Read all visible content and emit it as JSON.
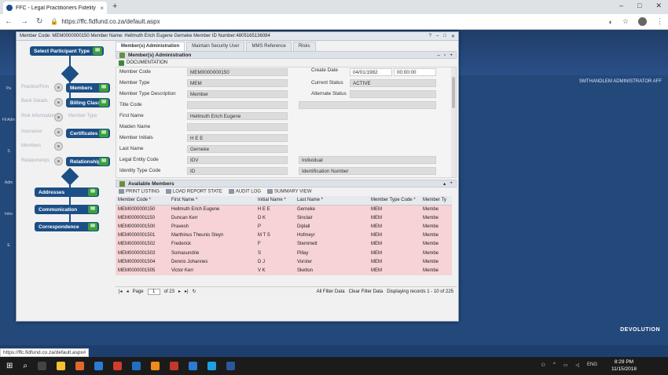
{
  "browser": {
    "tab_title": "FFC - Legal Practitioners Fidelity",
    "tab_close": "×",
    "new_tab": "+",
    "url": "https://ffc.fidfund.co.za/default.aspx",
    "status_url": "https://ffc.fidfund.co.za/default.aspx#",
    "win_controls": [
      "–",
      "□",
      "✕"
    ]
  },
  "app": {
    "user_bar": "SMTHANDLEM ADMINISTRATOR AFF",
    "brand": "DEVOLUTION",
    "side_labels": [
      "Pa",
      "Fil Adm",
      "S",
      "Adm",
      "Intro",
      "E"
    ]
  },
  "modal": {
    "title": "Member Code: MEM0000000150 Member Name: Hellmuth Erich Eugene Gerneke Member ID Number:4805165136084",
    "title_buttons": [
      "?",
      "–",
      "□",
      "✕"
    ]
  },
  "flow": {
    "start": "Select Participant Type",
    "members": "Members",
    "billing": "Billing Class",
    "certificates": "Certificates",
    "relationships": "Relationships",
    "addresses": "Addresses",
    "communication": "Communication",
    "correspondence": "Correspondence",
    "ghosts": [
      "Practice/Firm",
      "Bank Details",
      "Risk Information",
      "Member Type",
      "Insurance",
      "Members",
      "Relationships"
    ]
  },
  "tabs": [
    "Member(s) Administration",
    "Maintain Security User",
    "MMS Reference",
    "Risks"
  ],
  "admin_panel": {
    "title": "Member(s) Administration",
    "documentation": "DOCUMENTATION",
    "fields_left": [
      {
        "label": "Member Code",
        "value": "MEM0000000150"
      },
      {
        "label": "Member Type",
        "value": "MEM"
      },
      {
        "label": "Member Type Description",
        "value": "Member"
      },
      {
        "label": "Title Code",
        "value": ""
      },
      {
        "label": "First Name",
        "value": "Hellmuth Erich Eugene"
      },
      {
        "label": "Maiden Name",
        "value": ""
      },
      {
        "label": "Member Initials",
        "value": "H E E"
      },
      {
        "label": "Last Name",
        "value": "Gerneke"
      },
      {
        "label": "Legal Entity Code",
        "value": "IDV"
      },
      {
        "label": "Identity Type Code",
        "value": "ID"
      }
    ],
    "create_date_label": "Create Date",
    "create_date": "04/01/1982",
    "create_time": "00:00:00",
    "current_status_label": "Current Status",
    "current_status": "ACTIVE",
    "alternate_status_label": "Alternate Status",
    "legal_entity_desc": "Individual",
    "identity_type_desc": "Identification Number"
  },
  "available": {
    "title": "Available Members",
    "toolbar": [
      "PRINT LISTING",
      "LOAD REPORT STATE",
      "AUDIT LOG",
      "SUMMARY VIEW"
    ],
    "columns": [
      "Member Code *",
      "First Name *",
      "Initial Name *",
      "Last Name *",
      "Member Type Code *",
      "Member Ty"
    ],
    "rows": [
      [
        "MEM0000000150",
        "Hellmuth Erich Eugene",
        "H E E",
        "Gerneke",
        "MEM",
        "Membe"
      ],
      [
        "MEM0000001150",
        "Duncan Kerr",
        "D K",
        "Sinclair",
        "MEM",
        "Membe"
      ],
      [
        "MEM0000001500",
        "Pravesh",
        "P",
        "Diplall",
        "MEM",
        "Membe"
      ],
      [
        "MEM0000001501",
        "Marthinus Theunis Steyn",
        "M T S",
        "Hofmeyr",
        "MEM",
        "Membe"
      ],
      [
        "MEM0000001502",
        "Frederick",
        "F",
        "Stemmett",
        "MEM",
        "Membe"
      ],
      [
        "MEM0000001503",
        "Somasundrie",
        "S",
        "Pillay",
        "MEM",
        "Membe"
      ],
      [
        "MEM0000001504",
        "Dennis Johannes",
        "D J",
        "Vorster",
        "MEM",
        "Membe"
      ],
      [
        "MEM0000001505",
        "Victor Kerr",
        "V K",
        "Skelton",
        "MEM",
        "Membe"
      ]
    ],
    "page_label": "Page",
    "page_value": "1",
    "page_of": "of 23",
    "all_filter": "All Filter Data",
    "clear_filter": "Clear Filter Data",
    "display": "Displaying records 1 - 10 of 225"
  },
  "taskbar": {
    "lang": "ENG",
    "time": "8:29 PM",
    "date": "11/15/2018"
  }
}
